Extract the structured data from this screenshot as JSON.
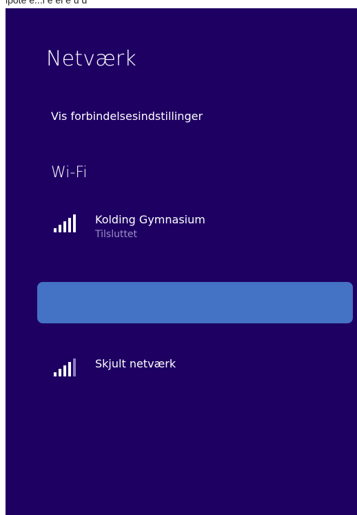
{
  "top_strip_text": "ipote e...l  e  el  e  u  d",
  "panel": {
    "title": "Netværk",
    "settings_link": "Vis forbindelsesindstillinger",
    "section_heading": "Wi-Fi",
    "networks": [
      {
        "name": "Kolding Gymnasium",
        "status": "Tilsluttet",
        "icon": "wifi-signal-icon"
      },
      {
        "name": "Skjult netværk",
        "status": "",
        "icon": "wifi-signal-icon"
      }
    ],
    "highlight_label": ""
  },
  "colors": {
    "panel_background": "#1e0063",
    "highlight": "#4472c4",
    "status_text": "#9a8fc6",
    "text": "#ffffff"
  }
}
